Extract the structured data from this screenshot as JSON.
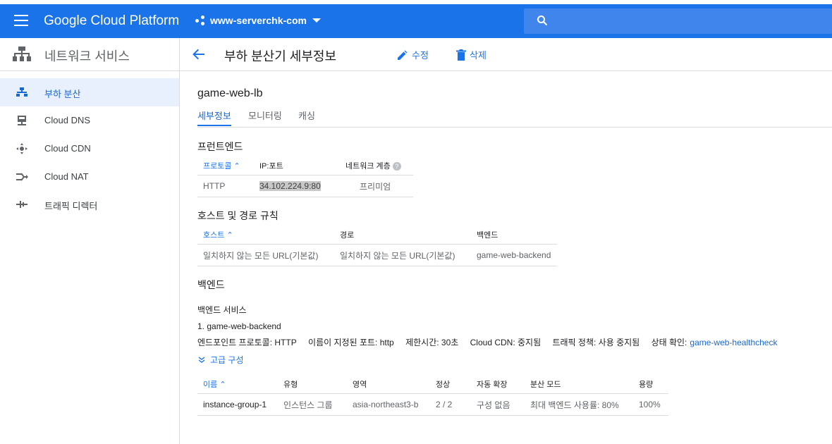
{
  "app": {
    "name": "Google Cloud Platform",
    "project": "www-serverchk-com"
  },
  "sidebar": {
    "title": "네트워크 서비스",
    "items": [
      {
        "label": "부하 분산",
        "icon": "load-balancing-icon",
        "active": true
      },
      {
        "label": "Cloud DNS",
        "icon": "dns-icon"
      },
      {
        "label": "Cloud CDN",
        "icon": "cdn-icon"
      },
      {
        "label": "Cloud NAT",
        "icon": "nat-icon"
      },
      {
        "label": "트래픽 디렉터",
        "icon": "traffic-director-icon"
      }
    ]
  },
  "page": {
    "title": "부하 분산기 세부정보",
    "edit_label": "수정",
    "delete_label": "삭제"
  },
  "lb_name": "game-web-lb",
  "tabs": [
    "세부정보",
    "모니터링",
    "캐싱"
  ],
  "frontend": {
    "title": "프런트엔드",
    "headers": [
      "프로토콜",
      "IP:포트",
      "네트워크 계층"
    ],
    "row": [
      "HTTP",
      "34.102.224.9:80",
      "프리미엄"
    ]
  },
  "host_rules": {
    "title": "호스트 및 경로 규칙",
    "headers": [
      "호스트",
      "경로",
      "백엔드"
    ],
    "row": [
      "일치하지 않는 모든 URL(기본값)",
      "일치하지 않는 모든 URL(기본값)",
      "game-web-backend"
    ]
  },
  "backend": {
    "title": "백엔드",
    "service_title": "백엔드 서비스",
    "service_name": "1. game-web-backend",
    "meta": {
      "endpoint_protocol": "엔드포인트 프로토콜: HTTP",
      "named_port": "이름이 지정된 포트: http",
      "timeout": "제한시간: 30초",
      "cdn": "Cloud CDN: 중지됨",
      "traffic_policy": "트래픽 정책: 사용 중지됨",
      "health_label": "상태 확인:",
      "health_link": "game-web-healthcheck"
    },
    "advanced_label": "고급 구성",
    "headers": [
      "이름",
      "유형",
      "영역",
      "정상",
      "자동 확장",
      "분산 모드",
      "용량"
    ],
    "row": [
      "instance-group-1",
      "인스턴스 그룹",
      "asia-northeast3-b",
      "2 / 2",
      "구성 없음",
      "최대 백엔드 사용률: 80%",
      "100%"
    ]
  }
}
